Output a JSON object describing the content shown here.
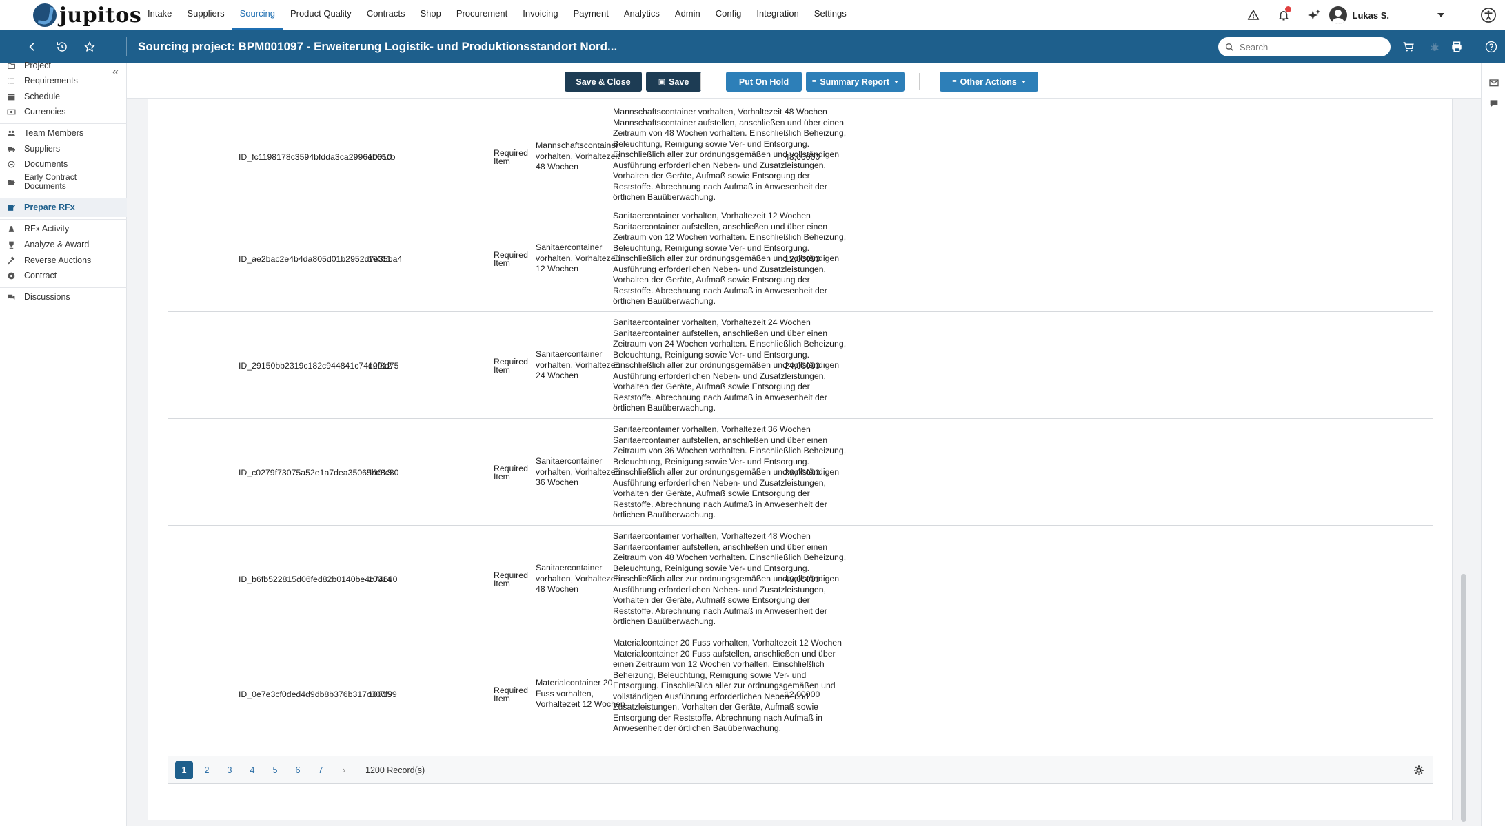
{
  "brand": {
    "name": "jupitos"
  },
  "nav": {
    "links": [
      "Intake",
      "Suppliers",
      "Sourcing",
      "Product Quality",
      "Contracts",
      "Shop",
      "Procurement",
      "Invoicing",
      "Payment",
      "Analytics",
      "Admin",
      "Config",
      "Integration",
      "Settings"
    ],
    "active": "Sourcing",
    "user": "Lukas S."
  },
  "titlebar": {
    "title": "Sourcing project: BPM001097 - Erweiterung Logistik- und Produktionsstandort Nord...",
    "search_placeholder": "Search"
  },
  "sidebar": {
    "items": [
      {
        "label": "Project",
        "icon": "folder-icon"
      },
      {
        "label": "Requirements",
        "icon": "list-icon"
      },
      {
        "label": "Schedule",
        "icon": "calendar-icon"
      },
      {
        "label": "Currencies",
        "icon": "money-icon"
      },
      {
        "label": "Team Members",
        "icon": "team-icon"
      },
      {
        "label": "Suppliers",
        "icon": "truck-icon"
      },
      {
        "label": "Documents",
        "icon": "document-icon"
      },
      {
        "label": "Early Contract Documents",
        "icon": "folder-open-icon"
      },
      {
        "label": "Prepare RFx",
        "icon": "edit-icon",
        "active": true
      },
      {
        "label": "RFx Activity",
        "icon": "activity-icon"
      },
      {
        "label": "Analyze & Award",
        "icon": "trophy-icon"
      },
      {
        "label": "Reverse Auctions",
        "icon": "gavel-icon"
      },
      {
        "label": "Contract",
        "icon": "contract-icon"
      },
      {
        "label": "Discussions",
        "icon": "chat-icon"
      }
    ]
  },
  "toolbar": {
    "save_close": "Save & Close",
    "save": "Save",
    "put_on_hold": "Put On Hold",
    "summary_report": "Summary Report",
    "other_actions": "Other Actions"
  },
  "table": {
    "rows": [
      {
        "id": "ID_fc1198178c3594bfdda3ca2996eb65cb",
        "position": "10010",
        "type": "Required Item",
        "short_text": "Mannschaftscontainer vorhalten, Vorhaltezeit 48 Wochen",
        "long_text": "Mannschaftscontainer vorhalten, Vorhaltezeit 48 Wochen Mannschaftscontainer aufstellen, anschließen und über einen Zeitraum von 48 Wochen vorhalten. Einschließlich Beheizung, Beleuchtung, Reinigung sowie Ver- und Entsorgung. Einschließlich aller zur ordnungsgemäßen und vollständigen Ausführung erforderlichen Neben- und Zusatzleistungen, Vorhalten der Geräte, Aufmaß sowie Entsorgung der Reststoffe. Abrechnung nach Aufmaß in Anwesenheit der örtlichen Bauüberwachung.",
        "quantity": "48,00000"
      },
      {
        "id": "ID_ae2bac2e4b4da805d01b2952d7e35ba4",
        "position": "10011",
        "type": "Required Item",
        "short_text": "Sanitaercontainer vorhalten, Vorhaltezeit 12 Wochen",
        "long_text": "Sanitaercontainer vorhalten, Vorhaltezeit 12 Wochen Sanitaercontainer aufstellen, anschließen und über einen Zeitraum von 12 Wochen vorhalten. Einschließlich Beheizung, Beleuchtung, Reinigung sowie Ver- und Entsorgung. Einschließlich aller zur ordnungsgemäßen und vollständigen Ausführung erforderlichen Neben- und Zusatzleistungen, Vorhalten der Geräte, Aufmaß sowie Entsorgung der Reststoffe. Abrechnung nach Aufmaß in Anwesenheit der örtlichen Bauüberwachung.",
        "quantity": "12,00000"
      },
      {
        "id": "ID_29150bb2319c182c944841c74d2f8d75",
        "position": "10012",
        "type": "Required Item",
        "short_text": "Sanitaercontainer vorhalten, Vorhaltezeit 24 Wochen",
        "long_text": "Sanitaercontainer vorhalten, Vorhaltezeit 24 Wochen Sanitaercontainer aufstellen, anschließen und über einen Zeitraum von 24 Wochen vorhalten. Einschließlich Beheizung, Beleuchtung, Reinigung sowie Ver- und Entsorgung. Einschließlich aller zur ordnungsgemäßen und vollständigen Ausführung erforderlichen Neben- und Zusatzleistungen, Vorhalten der Geräte, Aufmaß sowie Entsorgung der Reststoffe. Abrechnung nach Aufmaß in Anwesenheit der örtlichen Bauüberwachung.",
        "quantity": "24,00000"
      },
      {
        "id": "ID_c0279f73075a52e1a7dea35065bc8c80",
        "position": "10013",
        "type": "Required Item",
        "short_text": "Sanitaercontainer vorhalten, Vorhaltezeit 36 Wochen",
        "long_text": "Sanitaercontainer vorhalten, Vorhaltezeit 36 Wochen Sanitaercontainer aufstellen, anschließen und über einen Zeitraum von 36 Wochen vorhalten. Einschließlich Beheizung, Beleuchtung, Reinigung sowie Ver- und Entsorgung. Einschließlich aller zur ordnungsgemäßen und vollständigen Ausführung erforderlichen Neben- und Zusatzleistungen, Vorhalten der Geräte, Aufmaß sowie Entsorgung der Reststoffe. Abrechnung nach Aufmaß in Anwesenheit der örtlichen Bauüberwachung.",
        "quantity": "36,00000"
      },
      {
        "id": "ID_b6fb522815d06fed82b0140be4c74680",
        "position": "10014",
        "type": "Required Item",
        "short_text": "Sanitaercontainer vorhalten, Vorhaltezeit 48 Wochen",
        "long_text": "Sanitaercontainer vorhalten, Vorhaltezeit 48 Wochen Sanitaercontainer aufstellen, anschließen und über einen Zeitraum von 48 Wochen vorhalten. Einschließlich Beheizung, Beleuchtung, Reinigung sowie Ver- und Entsorgung. Einschließlich aller zur ordnungsgemäßen und vollständigen Ausführung erforderlichen Neben- und Zusatzleistungen, Vorhalten der Geräte, Aufmaß sowie Entsorgung der Reststoffe. Abrechnung nach Aufmaß in Anwesenheit der örtlichen Bauüberwachung.",
        "quantity": "48,00000"
      },
      {
        "id": "ID_0e7e3cf0ded4d9db8b376b317c007f99",
        "position": "10015",
        "type": "Required Item",
        "short_text": "Materialcontainer 20 Fuss vorhalten, Vorhaltezeit 12 Wochen",
        "long_text": "Materialcontainer 20 Fuss vorhalten, Vorhaltezeit 12 Wochen Materialcontainer 20 Fuss aufstellen, anschließen und über einen Zeitraum von 12 Wochen vorhalten. Einschließlich Beheizung, Beleuchtung, Reinigung sowie Ver- und Entsorgung. Einschließlich aller zur ordnungsgemäßen und vollständigen Ausführung erforderlichen Neben- und Zusatzleistungen, Vorhalten der Geräte, Aufmaß sowie Entsorgung der Reststoffe. Abrechnung nach Aufmaß in Anwesenheit der örtlichen Bauüberwachung.",
        "quantity": "12,00000"
      }
    ]
  },
  "pager": {
    "pages": [
      "1",
      "2",
      "3",
      "4",
      "5",
      "6",
      "7"
    ],
    "current": "1",
    "next": "›",
    "records": "1200 Record(s)"
  },
  "colors": {
    "brand": "#1e5f8c",
    "dark_button": "#1d3c54",
    "blue_button": "#2d7fb8"
  }
}
